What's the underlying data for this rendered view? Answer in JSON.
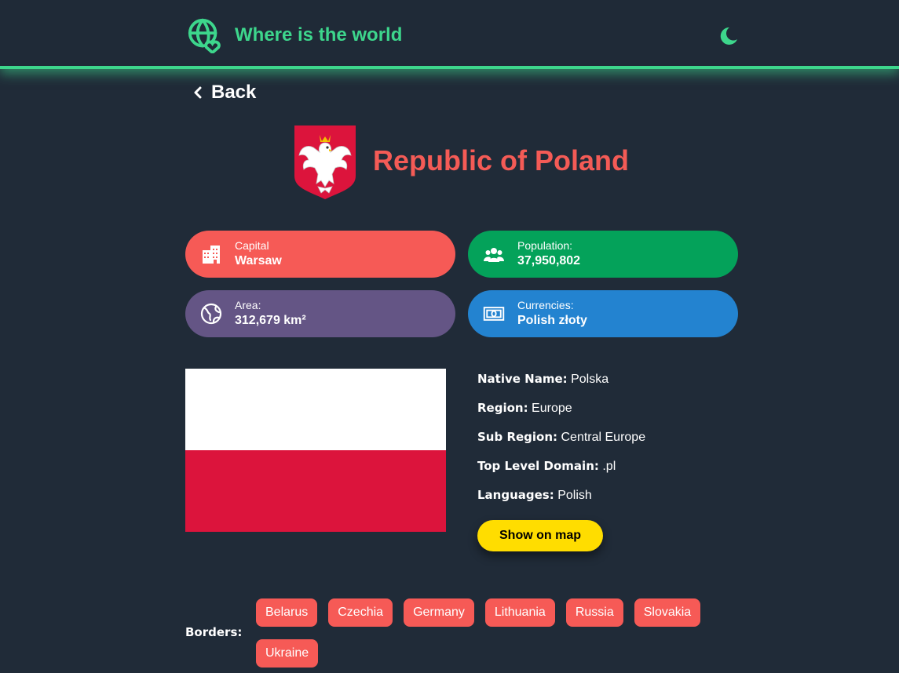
{
  "header": {
    "title": "Where is the world",
    "logo_icon": "globe-heart-icon",
    "theme_icon": "moon-icon",
    "accent": "#3dd68c"
  },
  "back": {
    "label": "Back"
  },
  "country": {
    "official_name": "Republic of Poland",
    "coat_of_arms_icon": "white-eagle-coat-of-arms",
    "flag_colors": [
      "#ffffff",
      "#dc143c"
    ]
  },
  "stats": {
    "capital": {
      "label": "Capital",
      "value": "Warsaw",
      "icon": "city-icon",
      "color": "#f65a56"
    },
    "population": {
      "label": "Population:",
      "value": "37,950,802",
      "icon": "people-icon",
      "color": "#04a25a"
    },
    "area": {
      "label": "Area:",
      "value": "312,679 km²",
      "icon": "globe-icon",
      "color": "#645585"
    },
    "currencies": {
      "label": "Currencies:",
      "value": "Polish złoty",
      "icon": "banknote-icon",
      "color": "#2383d0"
    }
  },
  "details": {
    "native_name": {
      "label": "Native Name:",
      "value": "Polska"
    },
    "region": {
      "label": "Region:",
      "value": "Europe"
    },
    "sub_region": {
      "label": "Sub Region:",
      "value": "Central Europe"
    },
    "tld": {
      "label": "Top Level Domain:",
      "value": ".pl"
    },
    "languages": {
      "label": "Languages:",
      "value": "Polish"
    }
  },
  "map_button": {
    "label": "Show on map",
    "color": "#ffdd00"
  },
  "borders": {
    "label": "Borders:",
    "countries": [
      "Belarus",
      "Czechia",
      "Germany",
      "Lithuania",
      "Russia",
      "Slovakia",
      "Ukraine"
    ]
  }
}
